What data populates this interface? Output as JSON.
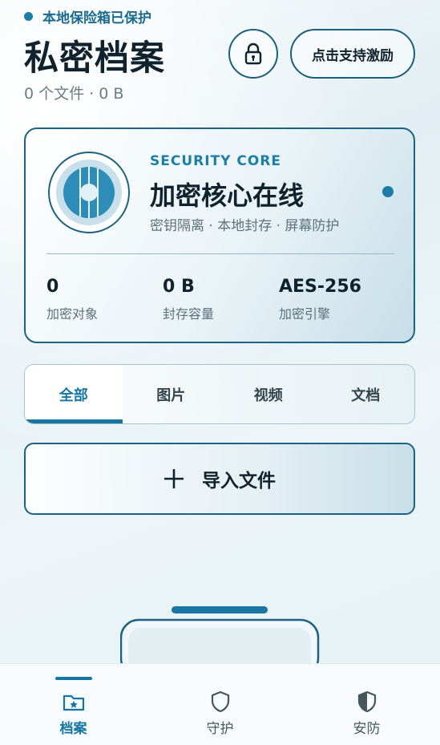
{
  "status": {
    "text": "本地保险箱已保护"
  },
  "header": {
    "title": "私密档案",
    "subtitle": "0 个文件 · 0 B",
    "support_label": "点击支持激励"
  },
  "core": {
    "eyebrow": "SECURITY CORE",
    "title": "加密核心在线",
    "desc": "密钥隔离 · 本地封存 · 屏幕防护",
    "stats": [
      {
        "value": "0",
        "label": "加密对象"
      },
      {
        "value": "0 B",
        "label": "封存容量"
      },
      {
        "value": "AES-256",
        "label": "加密引擎"
      }
    ]
  },
  "tabs": [
    {
      "label": "全部",
      "active": true
    },
    {
      "label": "图片",
      "active": false
    },
    {
      "label": "视频",
      "active": false
    },
    {
      "label": "文档",
      "active": false
    }
  ],
  "import": {
    "label": "导入文件"
  },
  "nav": [
    {
      "label": "档案",
      "icon": "folder-star-icon",
      "active": true
    },
    {
      "label": "守护",
      "icon": "shield-outline-icon",
      "active": false
    },
    {
      "label": "安防",
      "icon": "shield-half-icon",
      "active": false
    }
  ],
  "colors": {
    "accent": "#1676a1",
    "border": "#1b6383",
    "title": "#10232c"
  }
}
